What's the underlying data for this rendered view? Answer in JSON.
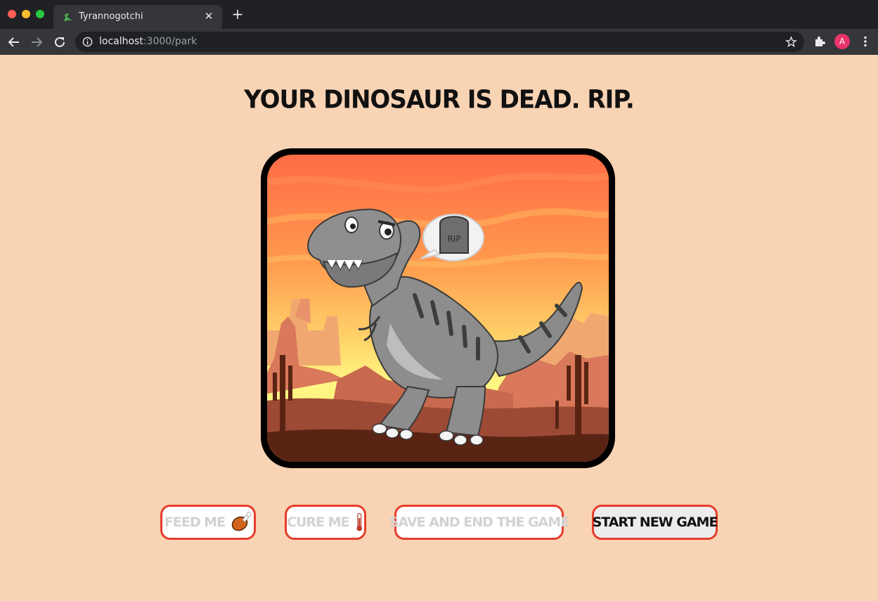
{
  "browser": {
    "tab_title": "Tyrannogotchi",
    "url_host": "localhost",
    "url_rest": ":3000/park",
    "avatar_letter": "A",
    "new_tab_symbol": "+",
    "close_symbol": "✕"
  },
  "page": {
    "headline": "YOUR DINOSAUR IS DEAD. RIP.",
    "speech_bubble_text": "RIP",
    "background_color": "#f8d3b4",
    "button_border_color": "#e83c2c"
  },
  "actions": {
    "feed_label": "FEED ME",
    "cure_label": "CURE ME",
    "save_label": "SAVE AND END THE GAME",
    "new_game_label": "START NEW GAME"
  },
  "icons": [
    "dinosaur-favicon-icon",
    "info-icon",
    "star-icon",
    "puzzle-extension-icon",
    "kebab-menu-icon",
    "back-arrow-icon",
    "forward-arrow-icon",
    "reload-icon",
    "drumstick-icon",
    "thermometer-icon"
  ]
}
